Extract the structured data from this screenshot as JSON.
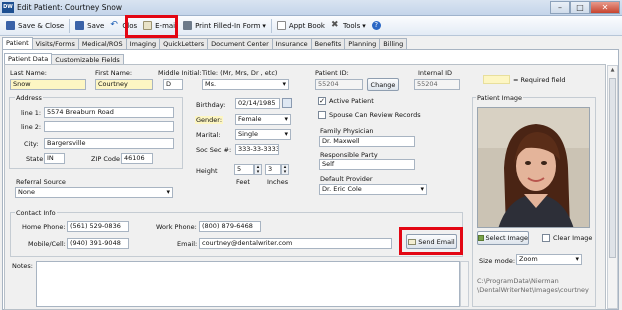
{
  "window": {
    "title": "Edit Patient: Courtney Snow",
    "app_icon": "DW"
  },
  "toolbar": {
    "save_close": "Save & Close",
    "save": "Save",
    "close": "Clos",
    "email": "E-mail",
    "print": "Print Filled-In Form",
    "appt": "Appt Book",
    "tools": "Tools"
  },
  "tabs": [
    "Patient",
    "Visits/Forms",
    "Medical/ROS",
    "Imaging",
    "QuickLetters",
    "Document Center",
    "Insurance",
    "Benefits",
    "Planning",
    "Billing"
  ],
  "subtabs": [
    "Patient Data",
    "Customizable Fields"
  ],
  "name": {
    "last_label": "Last Name:",
    "last": "Snow",
    "first_label": "First Name:",
    "first": "Courtney",
    "mi_label": "Middle Initial:",
    "mi": "D",
    "title_label": "Title: (Mr, Mrs, Dr , etc)",
    "title": "Ms."
  },
  "id": {
    "patient_label": "Patient ID:",
    "patient": "55204",
    "change": "Change",
    "internal_label": "Internal ID",
    "internal": "55204"
  },
  "required_note": "= Required field",
  "address": {
    "legend": "Address",
    "line1_label": "line 1:",
    "line1": "5574 Breaburn Road",
    "line2_label": "line 2:",
    "line2": "",
    "city_label": "City:",
    "city": "Bargersville",
    "state_label": "State",
    "state": "IN",
    "zip_label": "ZIP Code",
    "zip": "46106"
  },
  "personal": {
    "birthday_label": "Birthday:",
    "birthday": "02/14/1985",
    "gender_label": "Gender:",
    "gender": "Female",
    "marital_label": "Marital:",
    "marital": "Single",
    "ssn_label": "Soc Sec #:",
    "ssn": "333-33-3333",
    "height_label": "Height",
    "feet": "5",
    "inches": "3",
    "feet_label": "Feet",
    "inches_label": "Inches"
  },
  "status": {
    "active": "Active Patient",
    "spouse": "Spouse Can Review Records"
  },
  "physician": {
    "label": "Family Physician",
    "value": "Dr. Maxwell"
  },
  "responsible": {
    "label": "Responsible Party",
    "value": "Self"
  },
  "provider": {
    "label": "Default Provider",
    "value": "Dr. Eric Cole"
  },
  "referral": {
    "label": "Referral Source",
    "value": "None"
  },
  "contact": {
    "legend": "Contact Info",
    "home_label": "Home Phone:",
    "home": "(561) 529-0836",
    "work_label": "Work Phone:",
    "work": "(800) 879-6468",
    "mobile_label": "Mobile/Cell:",
    "mobile": "(940) 391-9048",
    "email_label": "Email:",
    "email": "courtney@dentalwriter.com",
    "send": "Send Email"
  },
  "notes": {
    "label": "Notes:"
  },
  "image": {
    "legend": "Patient Image",
    "select": "Select Image",
    "clear": "Clear Image",
    "size_label": "Size mode:",
    "size": "Zoom",
    "path1": "C:\\ProgramData\\Nierman",
    "path2": "\\DentalWriterNet\\Images\\courtney"
  },
  "colors": {
    "required": "#fdf6c3",
    "highlight": "#e30613"
  }
}
